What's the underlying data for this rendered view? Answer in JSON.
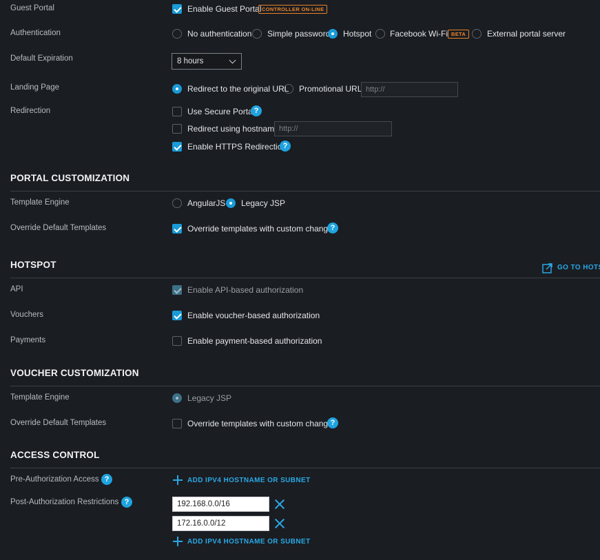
{
  "guest_portal": {
    "label": "Guest Portal",
    "enable_label": "Enable Guest Portal",
    "enabled": true,
    "badge": "CONTROLLER ON-LINE"
  },
  "authentication": {
    "label": "Authentication",
    "options": [
      "No authentication",
      "Simple password",
      "Hotspot",
      "Facebook Wi-Fi",
      "External portal server"
    ],
    "selected": "Hotspot",
    "beta_badge": "BETA"
  },
  "default_expiration": {
    "label": "Default Expiration",
    "value": "8 hours"
  },
  "landing_page": {
    "label": "Landing Page",
    "options": [
      "Redirect to the original URL",
      "Promotional URL"
    ],
    "selected": "Redirect to the original URL",
    "url_placeholder": "http://"
  },
  "redirection": {
    "label": "Redirection",
    "use_secure_portal": "Use Secure Portal",
    "use_secure_portal_checked": false,
    "redirect_hostname": "Redirect using hostname",
    "redirect_hostname_checked": false,
    "hostname_placeholder": "http://",
    "https_redirection": "Enable HTTPS Redirection",
    "https_redirection_checked": true
  },
  "portal_customization": {
    "title": "PORTAL CUSTOMIZATION",
    "template_engine_label": "Template Engine",
    "engines": [
      "AngularJS",
      "Legacy JSP"
    ],
    "engine_selected": "Legacy JSP",
    "override_label": "Override Default Templates",
    "override_text": "Override templates with custom changes",
    "override_checked": true
  },
  "hotspot": {
    "title": "HOTSPOT",
    "go_to_link": "GO TO HOTS",
    "api_label": "API",
    "api_text": "Enable API-based authorization",
    "api_checked": true,
    "vouchers_label": "Vouchers",
    "vouchers_text": "Enable voucher-based authorization",
    "vouchers_checked": true,
    "payments_label": "Payments",
    "payments_text": "Enable payment-based authorization",
    "payments_checked": false
  },
  "voucher_customization": {
    "title": "VOUCHER CUSTOMIZATION",
    "template_engine_label": "Template Engine",
    "engine": "Legacy JSP",
    "override_label": "Override Default Templates",
    "override_text": "Override templates with custom changes",
    "override_checked": false
  },
  "access_control": {
    "title": "ACCESS CONTROL",
    "pre_auth_label": "Pre-Authorization Access",
    "add_link": "ADD IPV4 HOSTNAME OR SUBNET",
    "post_auth_label": "Post-Authorization Restrictions",
    "post_auth_entries": [
      "192.168.0.0/16",
      "172.16.0.0/12"
    ]
  },
  "help_glyph": "?",
  "colors": {
    "accent": "#1a9bd8",
    "badge": "#e8832a",
    "background": "#1a1d21"
  }
}
